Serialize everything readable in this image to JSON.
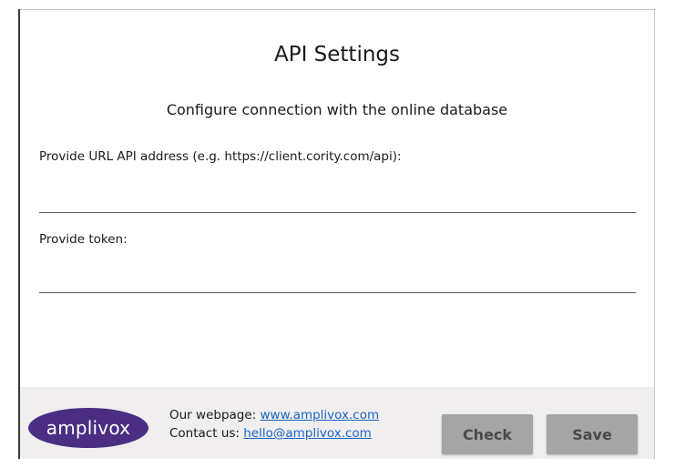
{
  "dialog": {
    "title": "API Settings",
    "subtitle": "Configure connection with the online database"
  },
  "form": {
    "url_label": "Provide URL API address (e.g. https://client.cority.com/api):",
    "url_value": "",
    "token_label": "Provide token:",
    "token_value": ""
  },
  "footer": {
    "logo_text": "amplivox",
    "webpage_label": "Our webpage:",
    "webpage_link": "www.amplivox.com",
    "contact_label": "Contact us:",
    "contact_link": "hello@amplivox.com",
    "check_label": "Check",
    "save_label": "Save"
  },
  "colors": {
    "logo_bg": "#4b2e83",
    "footer_bg": "#f0eeee",
    "button_bg": "#a5a5a5",
    "link": "#1a66c9"
  }
}
